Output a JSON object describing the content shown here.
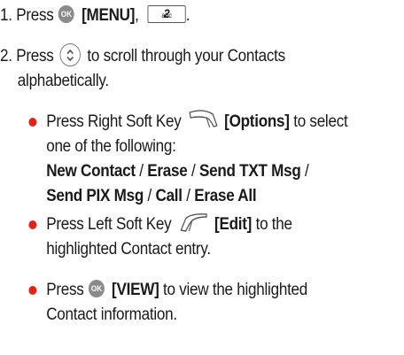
{
  "steps": [
    {
      "num": "1.",
      "text_press": "Press",
      "menu_label": "[MENU]",
      "sep": ",",
      "key2_main": "2",
      "key2_sub": "abc",
      "end": "."
    },
    {
      "num": "2.",
      "text_press": "Press",
      "text_rest_line1": "to scroll through your Contacts",
      "text_rest_line2": "alphabetically."
    }
  ],
  "bullets": [
    {
      "pre": "Press Right Soft Key",
      "label": "[Options]",
      "post1": "to select",
      "post2": "one of the following:",
      "options_line1": [
        {
          "t": "New Contact",
          "bold": true
        },
        {
          "t": " / ",
          "bold": false
        },
        {
          "t": "Erase",
          "bold": true
        },
        {
          "t": " / ",
          "bold": false
        },
        {
          "t": "Send TXT Msg",
          "bold": true
        },
        {
          "t": " /",
          "bold": false
        }
      ],
      "options_line2": [
        {
          "t": "Send PIX Msg",
          "bold": true
        },
        {
          "t": " / ",
          "bold": false
        },
        {
          "t": "Call",
          "bold": true
        },
        {
          "t": " / ",
          "bold": false
        },
        {
          "t": "Erase All",
          "bold": true
        }
      ]
    },
    {
      "pre": "Press Left Soft Key",
      "label": "[Edit]",
      "post1": "to the",
      "post2": "highlighted Contact entry."
    },
    {
      "pre": "Press",
      "label": "[VIEW]",
      "post1": "to view the highlighted",
      "post2": "Contact information."
    }
  ],
  "icons": {
    "ok_key_text": "OK"
  },
  "colors": {
    "bullet": "#e2231a",
    "text": "#1a1a1a",
    "ok_key_fill": "#8a8a8a"
  }
}
